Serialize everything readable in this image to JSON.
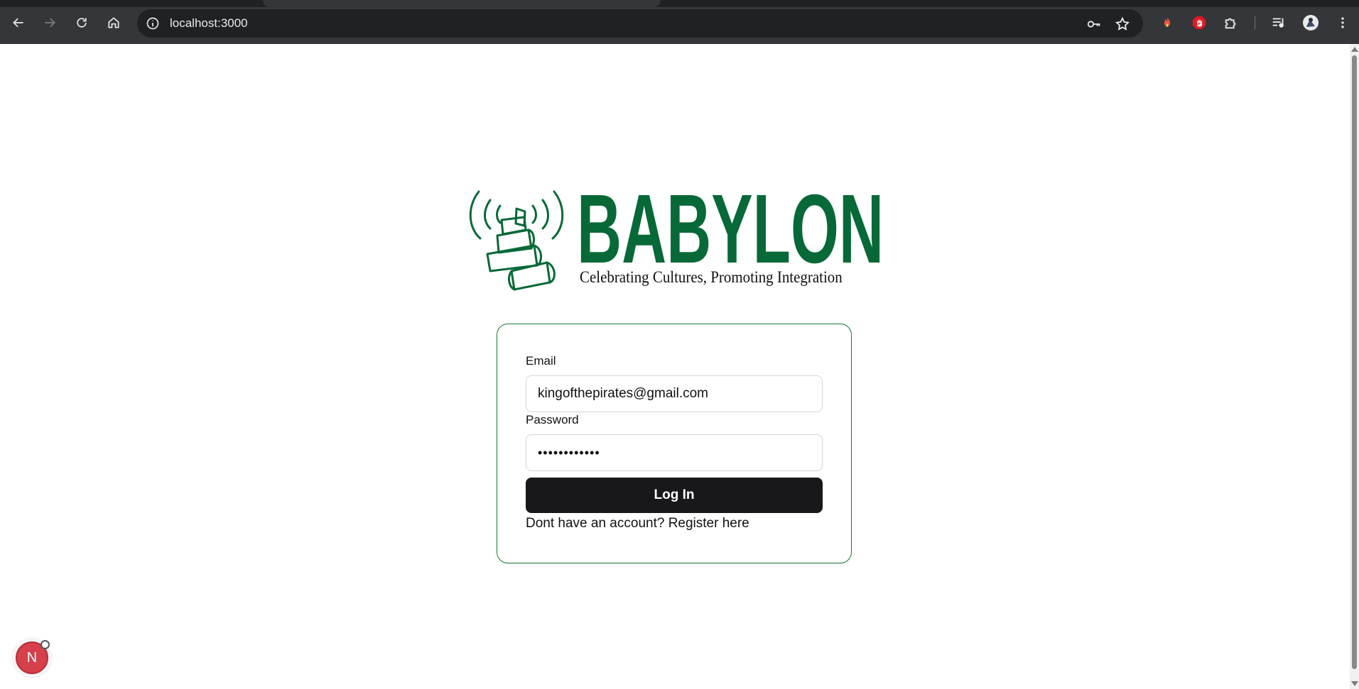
{
  "browser": {
    "url": "localhost:3000",
    "icons": [
      "back-arrow-icon",
      "forward-arrow-icon",
      "reload-icon",
      "home-icon",
      "info-icon",
      "key-icon",
      "star-icon",
      "extensions-icon",
      "media-queue-icon",
      "profile-avatar",
      "more-vert-icon"
    ]
  },
  "brand": {
    "name": "BABYLON",
    "tagline": "Celebrating Cultures, Promoting Integration",
    "color": "#076937"
  },
  "form": {
    "email_label": "Email",
    "email_value": "kingofthepirates@gmail.com",
    "password_label": "Password",
    "password_value": "••••••••••••",
    "login_label": "Log In",
    "register_text": "Dont have an account? Register here",
    "border_color": "#1d7a3c",
    "button_color": "#18181a"
  },
  "dev_badge": {
    "letter": "N",
    "color": "#d6404a"
  }
}
